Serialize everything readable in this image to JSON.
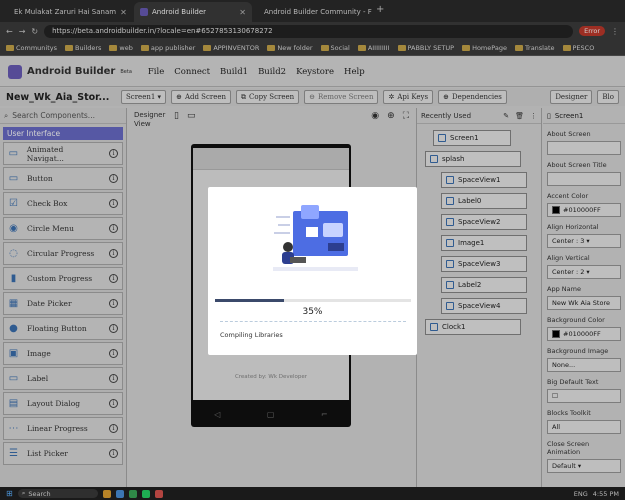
{
  "browser": {
    "tabs": [
      {
        "title": "Ek Mulakat Zaruri Hai Sanam",
        "icon": "youtube-icon",
        "color": "#e53935"
      },
      {
        "title": "Android Builder",
        "icon": "android-builder-icon",
        "color": "#6a5cb8"
      },
      {
        "title": "Android Builder Community - F",
        "icon": "community-icon",
        "color": "#4caf50"
      }
    ],
    "url": "https://beta.androidbuilder.in/?locale=en#6527853130678272",
    "error_label": "Error",
    "bookmarks": [
      "Communitys",
      "Builders",
      "web",
      "app publisher",
      "APPINVENTOR",
      "New folder",
      "Social",
      "AIIIIIIIII",
      "PABBLY SETUP",
      "HomePage",
      "Translate",
      "PESCO"
    ]
  },
  "app": {
    "logo": "Android Builder",
    "logo_tag": "Beta",
    "menu": [
      "File",
      "Connect",
      "Build1",
      "Build2",
      "Keystore",
      "Help"
    ]
  },
  "toolbar": {
    "project_name": "New_Wk_Aia_Stor...",
    "screen_select": "Screen1 ▾",
    "add_screen": "Add Screen",
    "copy_screen": "Copy Screen",
    "remove_screen": "Remove Screen",
    "api_keys": "Api Keys",
    "dependencies": "Dependencies",
    "designer": "Designer",
    "blocks": "Blo"
  },
  "palette": {
    "search_placeholder": "Search Components...",
    "category": "User Interface",
    "items": [
      {
        "label": "Animated Navigat...",
        "icon": "animated-navigation-icon",
        "glyph": "▭"
      },
      {
        "label": "Button",
        "icon": "button-icon",
        "glyph": "▭"
      },
      {
        "label": "Check Box",
        "icon": "checkbox-icon",
        "glyph": "☑"
      },
      {
        "label": "Circle Menu",
        "icon": "circle-menu-icon",
        "glyph": "◉"
      },
      {
        "label": "Circular Progress",
        "icon": "circular-progress-icon",
        "glyph": "◌"
      },
      {
        "label": "Custom Progress",
        "icon": "custom-progress-icon",
        "glyph": "▮"
      },
      {
        "label": "Date Picker",
        "icon": "date-picker-icon",
        "glyph": "▦"
      },
      {
        "label": "Floating Button",
        "icon": "floating-button-icon",
        "glyph": "●"
      },
      {
        "label": "Image",
        "icon": "image-icon",
        "glyph": "▣"
      },
      {
        "label": "Label",
        "icon": "label-icon",
        "glyph": "▭"
      },
      {
        "label": "Layout Dialog",
        "icon": "layout-dialog-icon",
        "glyph": "▤"
      },
      {
        "label": "Linear Progress",
        "icon": "linear-progress-icon",
        "glyph": "⋯"
      },
      {
        "label": "List Picker",
        "icon": "list-picker-icon",
        "glyph": "☰"
      }
    ]
  },
  "designer": {
    "label": "Designer View",
    "created_by": "Created by: Wk Developer"
  },
  "loading": {
    "progress_text": "35%",
    "progress": 0.35,
    "status": "Compiling Libraries"
  },
  "components": {
    "header": "Recently Used",
    "tree": [
      {
        "label": "Screen1",
        "depth": 0
      },
      {
        "label": "splash",
        "depth": 1
      },
      {
        "label": "SpaceView1",
        "depth": 2
      },
      {
        "label": "Label0",
        "depth": 2
      },
      {
        "label": "SpaceView2",
        "depth": 2
      },
      {
        "label": "Image1",
        "depth": 2
      },
      {
        "label": "SpaceView3",
        "depth": 2
      },
      {
        "label": "Label2",
        "depth": 2
      },
      {
        "label": "SpaceView4",
        "depth": 2
      },
      {
        "label": "Clock1",
        "depth": 1
      }
    ]
  },
  "properties": {
    "component": "Screen1",
    "items": [
      {
        "label": "About Screen",
        "value": ""
      },
      {
        "label": "About Screen Title",
        "value": ""
      },
      {
        "label": "Accent Color",
        "value": "#010000FF",
        "swatch": "#010000"
      },
      {
        "label": "Align Horizontal",
        "value": "Center : 3 ▾"
      },
      {
        "label": "Align Vertical",
        "value": "Center : 2 ▾"
      },
      {
        "label": "App Name",
        "value": "New Wk Aia Store"
      },
      {
        "label": "Background Color",
        "value": "#010000FF",
        "swatch": "#010000"
      },
      {
        "label": "Background Image",
        "value": "None..."
      },
      {
        "label": "Big Default Text",
        "value": "☐"
      },
      {
        "label": "Blocks Toolkit",
        "value": "All"
      },
      {
        "label": "Close Screen Animation",
        "value": "Default ▾"
      }
    ]
  },
  "taskbar": {
    "search": "Search",
    "lang": "ENG",
    "time": "4:55 PM"
  }
}
